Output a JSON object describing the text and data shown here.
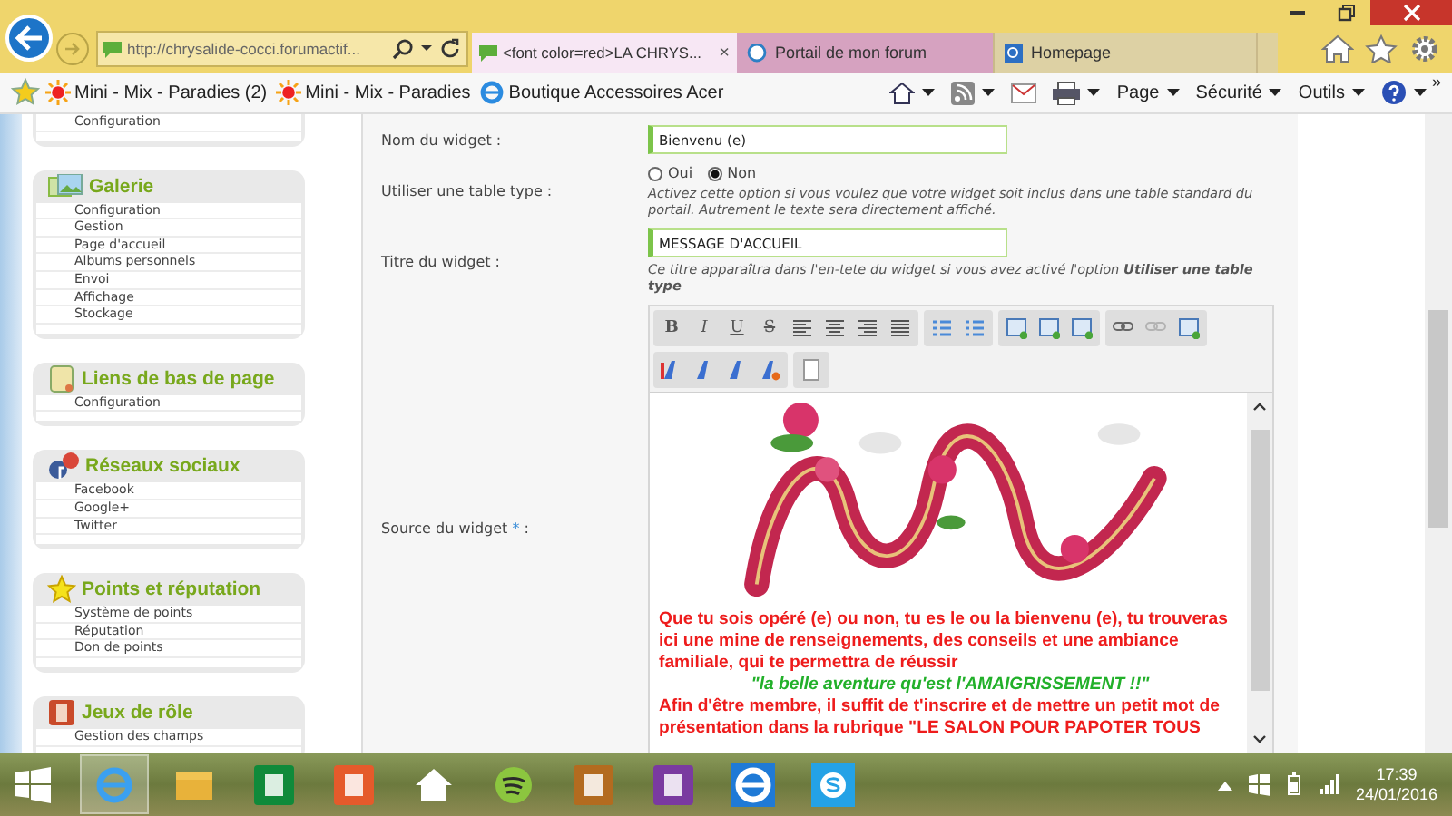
{
  "browser": {
    "address": "http://chrysalide-cocci.forumactif...",
    "tabs": [
      {
        "label": "<font color=red>LA CHRYS...",
        "selected": true,
        "close": "×"
      },
      {
        "label": "Portail de mon forum",
        "selected": false
      },
      {
        "label": "Homepage",
        "selected": false
      }
    ],
    "favorites": [
      "Mini - Mix - Paradies (2)",
      "Mini - Mix - Paradies",
      "Boutique Accessoires Acer"
    ],
    "commands": [
      "Page",
      "Sécurité",
      "Outils"
    ],
    "more": "»"
  },
  "sidebar": {
    "sections": [
      {
        "items": [
          "Configuration"
        ]
      },
      {
        "title": "Galerie",
        "items": [
          "Configuration",
          "Gestion",
          "Page d'accueil",
          "Albums personnels",
          "Envoi",
          "Affichage",
          "Stockage"
        ]
      },
      {
        "title": "Liens de bas de page",
        "items": [
          "Configuration"
        ]
      },
      {
        "title": "Réseaux sociaux",
        "items": [
          "Facebook",
          "Google+",
          "Twitter"
        ]
      },
      {
        "title": "Points et réputation",
        "items": [
          "Système de points",
          "Réputation",
          "Don de points"
        ]
      },
      {
        "title": "Jeux de rôle",
        "items": [
          "Gestion des champs"
        ]
      }
    ]
  },
  "form": {
    "name": {
      "label": "Nom du widget :",
      "value": "Bienvenu (e)"
    },
    "table_type": {
      "label": "Utiliser une table type :",
      "options": [
        {
          "label": "Oui",
          "selected": false
        },
        {
          "label": "Non",
          "selected": true
        }
      ],
      "help": "Activez cette option si vous voulez que votre widget soit inclus dans une table standard du portail. Autrement le texte sera directement affiché."
    },
    "title": {
      "label": "Titre du widget :",
      "value": "MESSAGE D'ACCUEIL",
      "help": "Ce titre apparaîtra dans l'en-tete du widget si vous avez activé l'option **Utiliser une table type**"
    },
    "source": {
      "label": "Source du widget",
      "required": "*",
      "colon": ":"
    }
  },
  "editor": {
    "format_buttons": [
      "B",
      "I",
      "U",
      "S"
    ],
    "icon_buttons": [
      {
        "disabled": false
      },
      {
        "disabled": false
      },
      {
        "disabled": false
      },
      {
        "disabled": false
      },
      {
        "disabled": false
      },
      {
        "disabled": false
      },
      {
        "disabled": false
      },
      {
        "disabled": false
      },
      {
        "disabled": false
      },
      {
        "disabled": false
      },
      {
        "disabled": true
      },
      {
        "disabled": false
      },
      {
        "disabled": false
      },
      {
        "disabled": false
      },
      {
        "disabled": false
      },
      {
        "disabled": false
      },
      {
        "disabled": false
      }
    ],
    "content": {
      "kind": "picture",
      "paragraphs": [
        {
          "kind": "red",
          "text": "Que tu sois opéré (e) ou non, tu es le ou la bienvenu (e), tu trouveras ici une mine de renseignements, des conseils et une ambiance familiale, qui te permettra de réussir"
        },
        {
          "kind": "green",
          "text": "\"la belle aventure qu'est l'AMAIGRISSEMENT !!\""
        },
        {
          "kind": "red",
          "text": "Afin d'être membre, il suffit de t'inscrire et de mettre un petit mot de présentation dans la rubrique \"LE SALON POUR PAPOTER TOUS"
        }
      ]
    }
  },
  "taskbar": {
    "time": "17:39",
    "date": "24/01/2016"
  }
}
